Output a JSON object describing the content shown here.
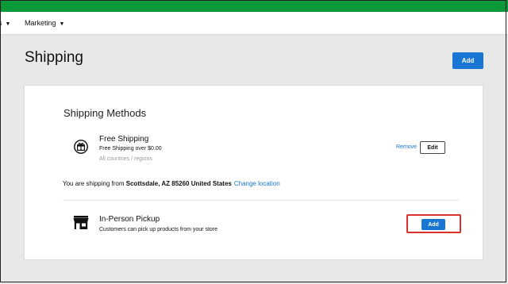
{
  "topnav": {
    "cut_item_label": "s",
    "marketing_label": "Marketing"
  },
  "page": {
    "title": "Shipping",
    "add_label": "Add"
  },
  "card": {
    "section_title": "Shipping Methods",
    "free_shipping": {
      "name": "Free Shipping",
      "description": "Free Shipping over $0.00",
      "regions": "All countries / regions",
      "remove_label": "Remove",
      "edit_label": "Edit",
      "icon": "gift-icon"
    },
    "shipping_from": {
      "prefix": "You are shipping from",
      "location": "Scottsdale, AZ 85260 United States",
      "change_label": "Change location"
    },
    "pickup": {
      "name": "In-Person Pickup",
      "description": "Customers can pick up products from your store",
      "add_label": "Add",
      "icon": "store-icon"
    }
  },
  "colors": {
    "brand_green": "#0a9a3a",
    "primary_blue": "#1976d2",
    "highlight_red": "#d9302b"
  }
}
